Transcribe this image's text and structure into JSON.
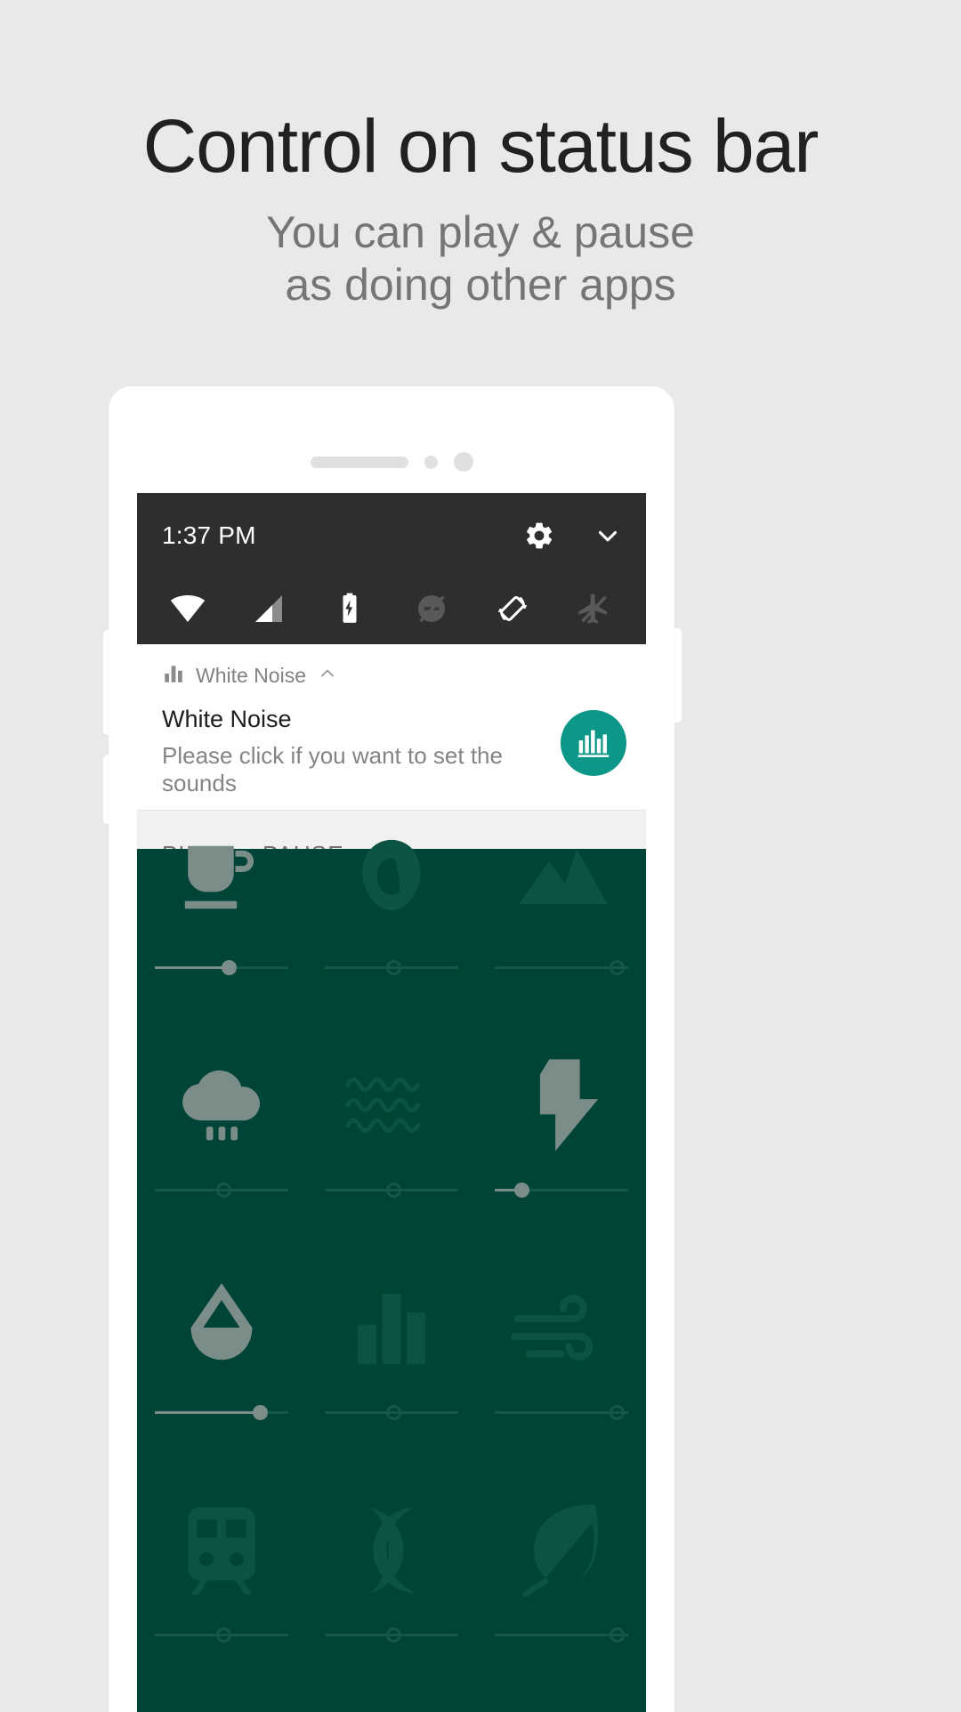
{
  "promo": {
    "title": "Control on status bar",
    "subtitle_line1": "You can play & pause",
    "subtitle_line2": "as doing other apps"
  },
  "colors": {
    "page_background": "#e9e9e9",
    "title": "#212121",
    "subtitle": "#757575",
    "quick_settings_panel": "#2e2e2e",
    "app_accent_teal": "#0d9789",
    "app_background_teal": "#004438",
    "notification_actions_background": "#f1f1f1"
  },
  "phone": {
    "speaker": {
      "grille": "speaker-grille",
      "sensor_small": "proximity-sensor-dot",
      "camera": "front-camera-dot"
    },
    "buttons": [
      "volume-up-button",
      "volume-down-button",
      "power-button"
    ]
  },
  "status_bar": {
    "time": "1:37 PM",
    "settings_icon": "gear-icon",
    "collapse_icon": "chevron-down-icon",
    "quick_settings": [
      {
        "name": "wifi-icon",
        "state": "on"
      },
      {
        "name": "cellular-signal-icon",
        "state": "on"
      },
      {
        "name": "battery-charging-icon",
        "state": "on"
      },
      {
        "name": "do-not-disturb-off-icon",
        "state": "off"
      },
      {
        "name": "auto-rotate-icon",
        "state": "on"
      },
      {
        "name": "airplane-mode-off-icon",
        "state": "off"
      }
    ]
  },
  "notification": {
    "app_icon": "equalizer-bars-icon",
    "app_name": "White Noise",
    "expand_icon": "chevron-up-icon",
    "title": "White Noise",
    "description": "Please click if you want to set the sounds",
    "large_icon": "white-noise-app-icon",
    "actions": [
      {
        "label": "PLAY",
        "name": "play-action-button"
      },
      {
        "label": "PAUSE",
        "name": "pause-action-button"
      }
    ]
  },
  "sound_grid": {
    "items": [
      {
        "name": "coffee-cup-sound",
        "icon": "coffee-cup-icon",
        "volume": 55,
        "active": true
      },
      {
        "name": "leaf-drop-sound",
        "icon": "leaf-drop-icon",
        "volume": 0,
        "active": false
      },
      {
        "name": "mountains-sound",
        "icon": "mountains-icon",
        "volume": 0,
        "active": false
      },
      {
        "name": "rain-cloud-sound",
        "icon": "rain-cloud-icon",
        "volume": 0,
        "active": false
      },
      {
        "name": "waves-sound",
        "icon": "waves-icon",
        "volume": 0,
        "active": false
      },
      {
        "name": "thunder-sound",
        "icon": "lightning-bolt-icon",
        "volume": 20,
        "active": true
      },
      {
        "name": "water-drop-sound",
        "icon": "water-drop-icon",
        "volume": 78,
        "active": true
      },
      {
        "name": "equalizer-sound",
        "icon": "bar-chart-icon",
        "volume": 0,
        "active": false
      },
      {
        "name": "wind-sound",
        "icon": "wind-icon",
        "volume": 0,
        "active": false
      },
      {
        "name": "train-sound",
        "icon": "train-icon",
        "volume": 0,
        "active": false
      },
      {
        "name": "night-sound",
        "icon": "crescent-moon-icon",
        "volume": 0,
        "active": false
      },
      {
        "name": "forest-sound",
        "icon": "leaf-icon",
        "volume": 0,
        "active": false
      }
    ]
  }
}
